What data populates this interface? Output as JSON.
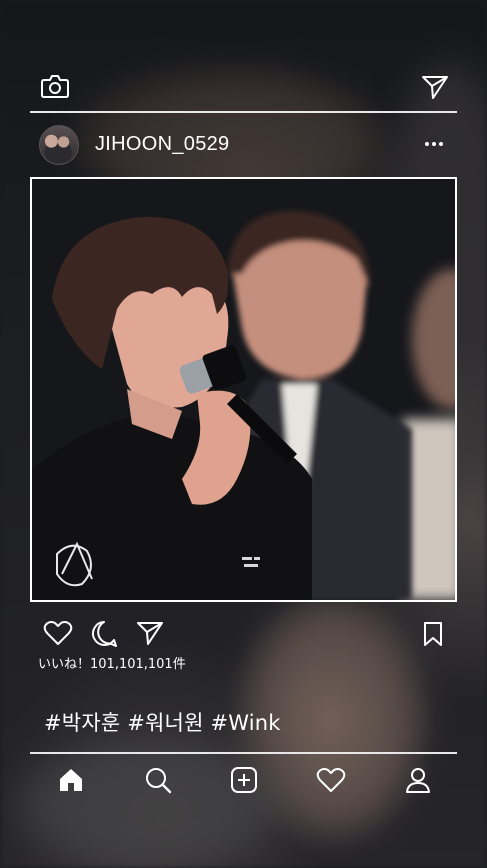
{
  "header": {
    "camera_icon": "camera-icon",
    "send_icon": "paper-plane-icon"
  },
  "post": {
    "username": "JIHOON_0529",
    "more_icon": "more-horizontal-icon",
    "likes_text": "いいね！101,101,101件",
    "hashtags": "#박자훈 #워너원 #Wink"
  },
  "actions": [
    "heart-icon",
    "comment-icon",
    "share-icon",
    "bookmark-icon"
  ],
  "bottom_nav": [
    "home-icon",
    "search-icon",
    "add-post-icon",
    "activity-heart-icon",
    "profile-icon"
  ],
  "colors": {
    "foreground": "#ffffff",
    "divider": "#e8e8e8",
    "background": "#1b1c1f"
  }
}
